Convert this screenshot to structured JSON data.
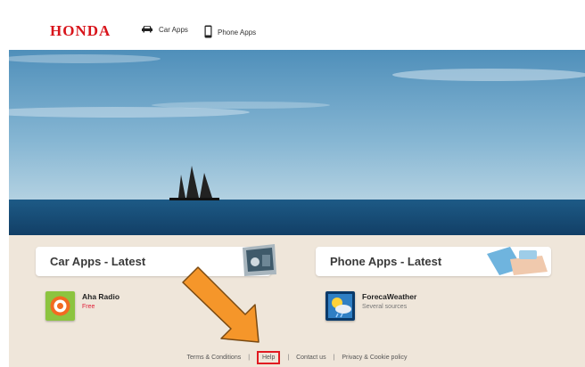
{
  "brand": {
    "logo_text": "HONDA",
    "color": "#d8141b"
  },
  "nav": [
    {
      "label": "Car Apps",
      "icon": "car-icon"
    },
    {
      "label": "Phone Apps",
      "icon": "phone-icon"
    }
  ],
  "sections": {
    "car": {
      "title": "Car Apps - Latest",
      "apps": [
        {
          "name": "Aha Radio",
          "subtitle": "Free",
          "icon": "aha-radio-app-icon"
        }
      ]
    },
    "phone": {
      "title": "Phone Apps - Latest",
      "apps": [
        {
          "name": "ForecaWeather",
          "subtitle": "Several sources",
          "icon": "forecaweather-app-icon"
        }
      ]
    }
  },
  "footer": {
    "links": [
      "Terms & Conditions",
      "Help",
      "Contact us",
      "Privacy & Cookie policy"
    ],
    "separator": "|",
    "highlighted": "Help",
    "highlight_color": "#e11b22"
  },
  "annotation": {
    "arrow_color": "#f5962a",
    "target": "Help"
  }
}
